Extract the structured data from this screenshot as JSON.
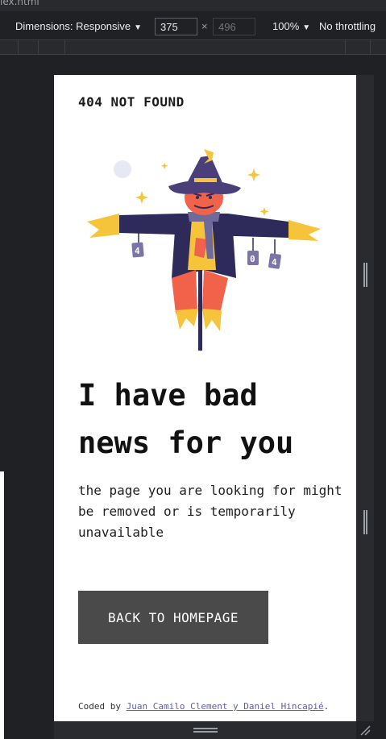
{
  "devtools": {
    "tab_file": "lex.html",
    "dimensions_label": "Dimensions: Responsive",
    "width_value": "375",
    "times": "×",
    "height_placeholder": "496",
    "zoom_label": "100%",
    "throttle_label": "No throttling",
    "caret": "▼"
  },
  "page": {
    "brand": "404 NOT FOUND",
    "headline": "I have bad news for you",
    "message": "the page you are looking for might be removed or is temporarily unavailable",
    "button_label": "BACK TO HOMEPAGE",
    "credits": {
      "prefix": "Coded by ",
      "link_text": "Juan Camilo Clement y Daniel Hincapié",
      "suffix": "."
    },
    "illustration": {
      "sign_left": "4",
      "sign_mid": "0",
      "sign_right": "4",
      "colors": {
        "hat": "#4a3f78",
        "coat": "#2e2a5a",
        "face": "#f0634a",
        "straw": "#f6c43b",
        "scarf": "#6f6a9a",
        "sign": "#7a74a8"
      }
    }
  }
}
